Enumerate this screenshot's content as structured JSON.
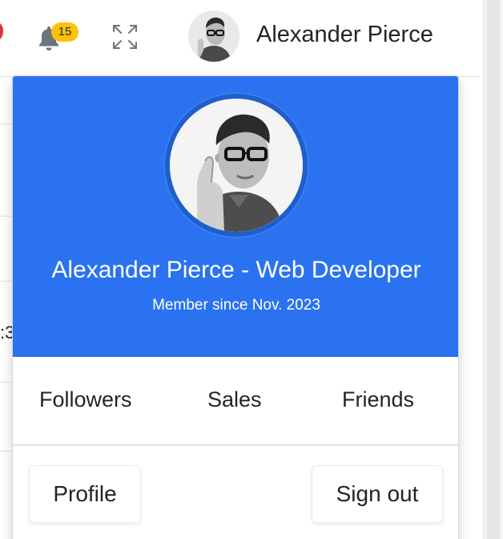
{
  "navbar": {
    "notification_count": "15",
    "user_name": "Alexander Pierce"
  },
  "background": {
    "peek_text": ":3"
  },
  "user_dropdown": {
    "header": {
      "title": "Alexander Pierce - Web Developer",
      "subtitle": "Member since Nov. 2023",
      "color": "#2a72f0"
    },
    "links": [
      {
        "label": "Followers"
      },
      {
        "label": "Sales"
      },
      {
        "label": "Friends"
      }
    ],
    "footer": {
      "profile_label": "Profile",
      "signout_label": "Sign out"
    }
  },
  "icons": {
    "bell": "bell-icon",
    "expand": "fullscreen-icon",
    "notification_badge_color": "#ffc107"
  }
}
